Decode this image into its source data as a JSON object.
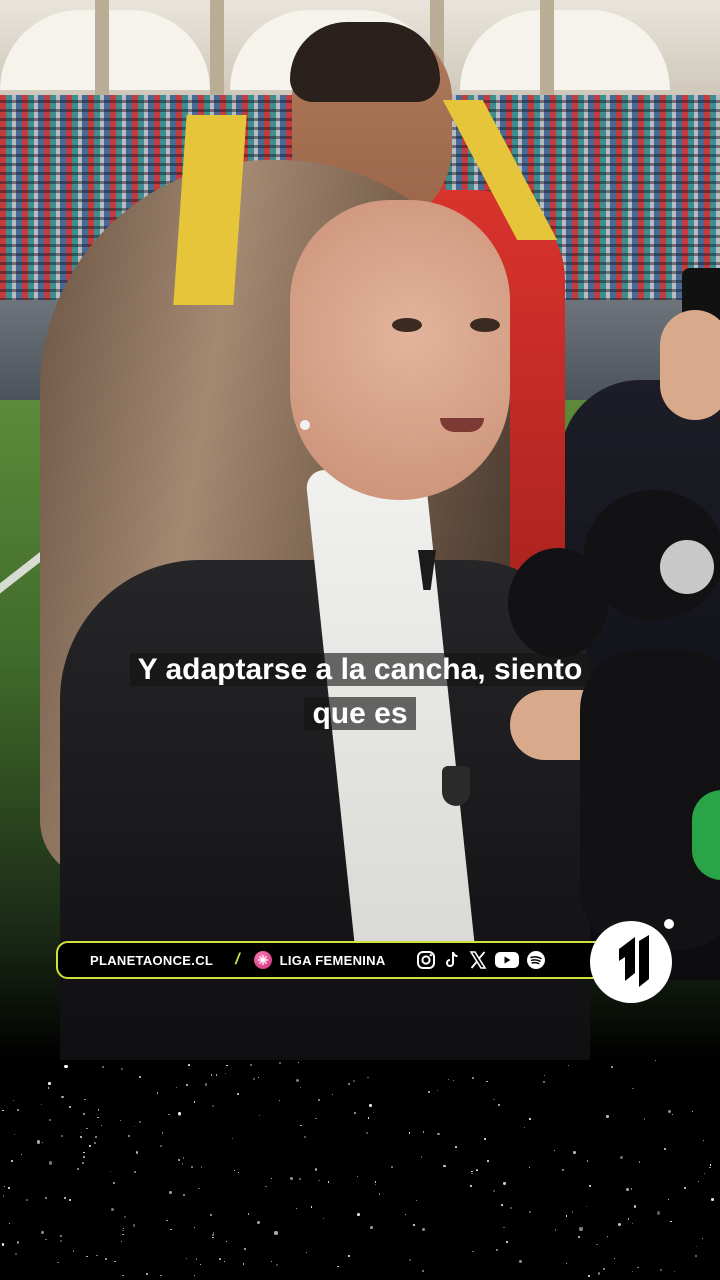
{
  "subtitle": {
    "line1": "Y adaptarse a la cancha, siento",
    "line2": "que es"
  },
  "brand_bar": {
    "site": "PLANETAONCE.CL",
    "separator": "/",
    "league": "LIGA FEMENINA",
    "social_icons": [
      "instagram-icon",
      "tiktok-icon",
      "x-icon",
      "youtube-icon",
      "spotify-icon"
    ],
    "accent_color": "#cfe23a"
  },
  "logo": {
    "icon": "planetaonce-logo"
  }
}
